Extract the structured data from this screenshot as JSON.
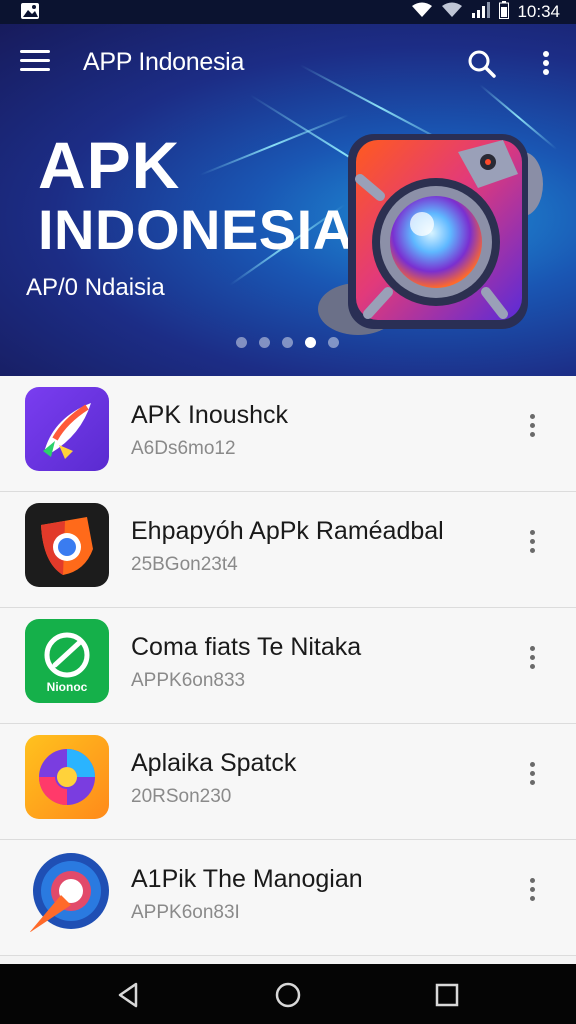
{
  "status_bar": {
    "time": "10:34",
    "icons": [
      "gallery-icon",
      "wifi-icon",
      "signal-icon",
      "battery-icon"
    ]
  },
  "app_bar": {
    "title": "APP Indonesia",
    "icons": [
      "menu-icon",
      "search-icon",
      "more-vert-icon"
    ]
  },
  "hero": {
    "title_line1": "APK",
    "title_line2": "INDONESIA",
    "subtitle": "AP/0 Ndaisia",
    "dots_count": 5,
    "active_dot": 3
  },
  "apps": [
    {
      "name": "APK Inoushck",
      "size": "A6Ds6mo12",
      "icon": "rocket-icon",
      "colors": [
        "#6a3de8",
        "#9b4dff"
      ]
    },
    {
      "name": "Ehpapyóh ApPk Raméadbal",
      "size": "25BGon23t4",
      "icon": "browser-shield-icon",
      "colors": [
        "#1c1c1c",
        "#2a2a2a"
      ]
    },
    {
      "name": "Coma fiats Te Nitaka",
      "size": "APPK6on833",
      "icon": "tools-badge-icon",
      "colors": [
        "#12b24a",
        "#0a9a3c"
      ],
      "icon_text": "Nionoc"
    },
    {
      "name": "Aplaika Spatck",
      "size": "20RSon230",
      "icon": "swirl-icon",
      "colors": [
        "#ffb21e",
        "#ff7a1a"
      ]
    },
    {
      "name": "A1Pik The Manogian",
      "size": "APPK6on83I",
      "icon": "globe-rocket-icon",
      "colors": [
        "#1f4fb4",
        "#e0572a"
      ]
    }
  ],
  "nav_bar": {
    "buttons": [
      "back-icon",
      "home-icon",
      "recents-icon"
    ]
  },
  "colors": {
    "hero_dark": "#171b5c",
    "hero_light": "#1e8fd6",
    "list_bg": "#f7f7f7",
    "nav_bg": "#050505"
  }
}
